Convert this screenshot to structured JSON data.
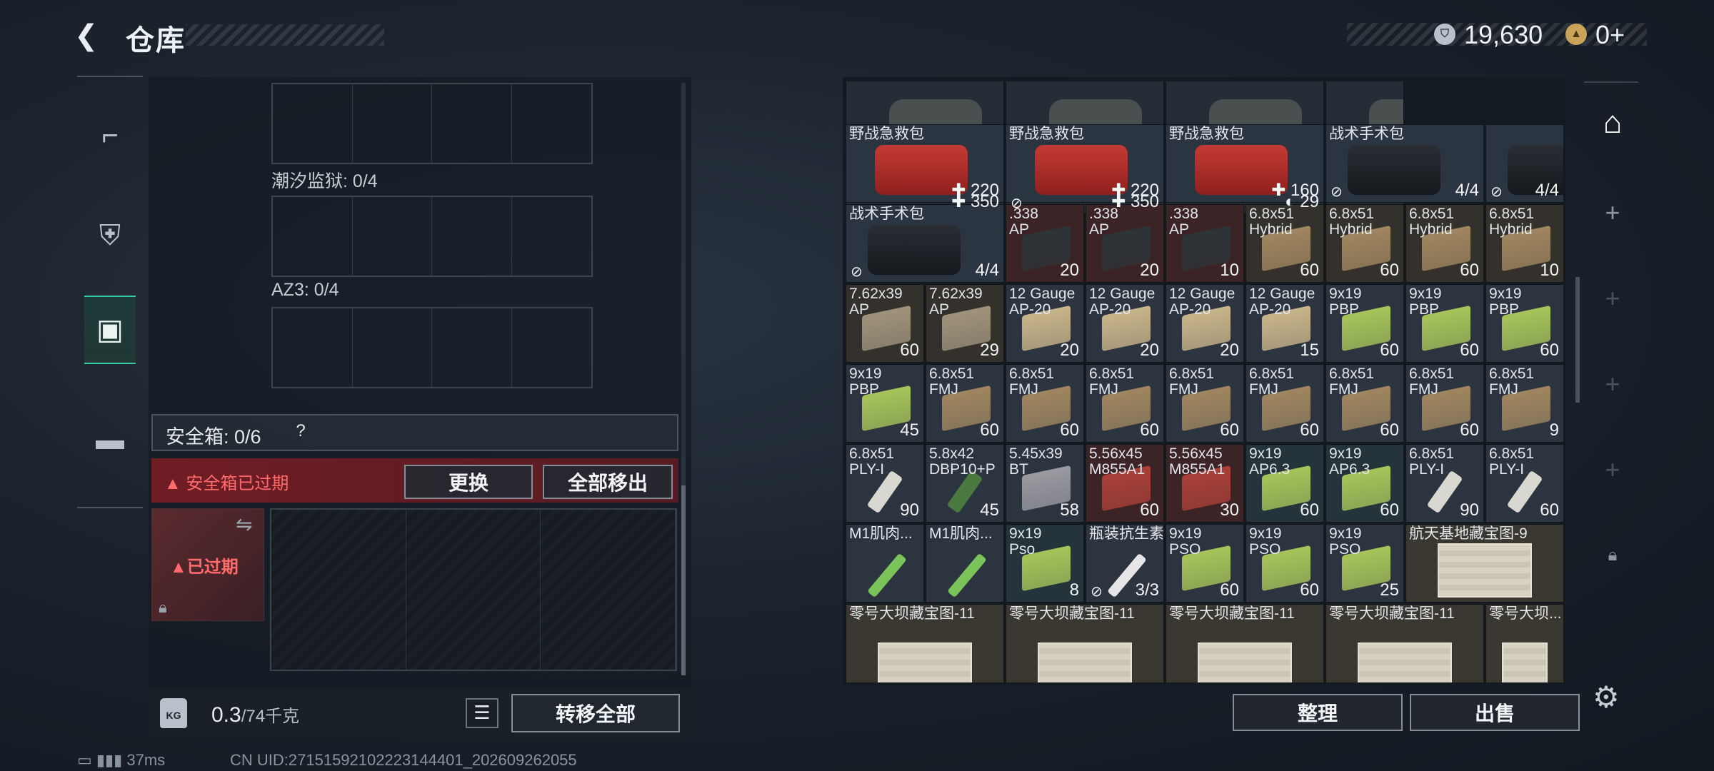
{
  "header": {
    "title": "仓库",
    "back_icon": "back-arrow-icon"
  },
  "currency": {
    "silver": "19,630",
    "gold": "0+"
  },
  "tabs": [
    {
      "name": "weapons",
      "icon": "pistol-icon",
      "active": false
    },
    {
      "name": "armor",
      "icon": "vest-icon",
      "active": false
    },
    {
      "name": "backpack",
      "icon": "backpack-icon",
      "active": true
    },
    {
      "name": "cases",
      "icon": "briefcase-icon",
      "active": false
    }
  ],
  "left": {
    "slot_labels": [
      "潮汐监狱: 0/4",
      "AZ3: 0/4"
    ],
    "safebox": {
      "title": "安全箱: 0/6",
      "help": "?",
      "expired_msg": "安全箱已过期",
      "replace": "更换",
      "move_all": "全部移出",
      "case_label": "已过期"
    },
    "weight": {
      "current": "0.3",
      "max": "/74千克",
      "kg_label": "KG"
    },
    "transfer_all": "转移全部"
  },
  "status": {
    "ping": "37ms",
    "uid": "CN UID:27151592102223144401_202609262055"
  },
  "stash": {
    "rows": [
      [
        {
          "c": "✚ 350",
          "t": "bag"
        },
        {
          "c": "✚ 350",
          "t": "bag",
          "i": "⊘"
        },
        {
          "c": "◐ 29",
          "t": "bag"
        },
        {
          "c": "",
          "t": "bag"
        }
      ],
      [
        {
          "n": "野战急救包",
          "c": "✚ 220",
          "t": "kit"
        },
        {
          "n": "野战急救包",
          "c": "✚ 220",
          "t": "kit"
        },
        {
          "n": "野战急救包",
          "c": "✚ 160",
          "t": "kit"
        },
        {
          "n": "战术手术包",
          "c": "4/4",
          "t": "dkit",
          "i": "⊘"
        },
        {
          "n": "",
          "c": "4/4",
          "t": "dkit",
          "i": "⊘"
        }
      ],
      [
        {
          "n": "战术手术包",
          "c": "4/4",
          "t": "dkit",
          "i": "⊘"
        },
        {
          "n": ".338\nAP",
          "c": "20",
          "t": "ammo",
          "bg": "#3b2326",
          "col": "#2d3438"
        },
        {
          "n": ".338\nAP",
          "c": "20",
          "t": "ammo",
          "bg": "#3b2326",
          "col": "#2d3438"
        },
        {
          "n": ".338\nAP",
          "c": "10",
          "t": "ammo",
          "bg": "#3b2326",
          "col": "#2d3438"
        },
        {
          "n": "6.8x51\nHybrid",
          "c": "60",
          "t": "ammo",
          "bg": "#34302b",
          "col": "#a08660"
        },
        {
          "n": "6.8x51\nHybrid",
          "c": "60",
          "t": "ammo",
          "bg": "#34302b",
          "col": "#a08660"
        },
        {
          "n": "6.8x51\nHybrid",
          "c": "60",
          "t": "ammo",
          "bg": "#34302b",
          "col": "#a08660"
        },
        {
          "n": "6.8x51\nHybrid",
          "c": "10",
          "t": "ammo",
          "bg": "#34302b",
          "col": "#a08660"
        }
      ],
      [
        {
          "n": "7.62x39\nAP",
          "c": "60",
          "t": "ammo",
          "bg": "#34302b",
          "col": "#9f937b"
        },
        {
          "n": "7.62x39\nAP",
          "c": "29",
          "t": "ammo",
          "bg": "#34302b",
          "col": "#9f937b"
        },
        {
          "n": "12 Gauge\nAP-20",
          "c": "20",
          "t": "ammo",
          "bg": "#2c3440",
          "col": "#c9b48a"
        },
        {
          "n": "12 Gauge\nAP-20",
          "c": "20",
          "t": "ammo",
          "bg": "#2c3440",
          "col": "#c9b48a"
        },
        {
          "n": "12 Gauge\nAP-20",
          "c": "20",
          "t": "ammo",
          "bg": "#2c3440",
          "col": "#c9b48a"
        },
        {
          "n": "12 Gauge\nAP-20",
          "c": "15",
          "t": "ammo",
          "bg": "#2c3440",
          "col": "#c9b48a"
        },
        {
          "n": "9x19\nPBP",
          "c": "60",
          "t": "ammo",
          "bg": "#2c3440",
          "col": "#a7c45a"
        },
        {
          "n": "9x19\nPBP",
          "c": "60",
          "t": "ammo",
          "bg": "#2c3440",
          "col": "#a7c45a"
        },
        {
          "n": "9x19\nPBP",
          "c": "60",
          "t": "ammo",
          "bg": "#2c3440",
          "col": "#a7c45a"
        }
      ],
      [
        {
          "n": "9x19\nPBP",
          "c": "45",
          "t": "ammo",
          "bg": "#2c3440",
          "col": "#a7c45a"
        },
        {
          "n": "6.8x51\nFMJ",
          "c": "60",
          "t": "ammo",
          "bg": "#2c3440",
          "col": "#a08660"
        },
        {
          "n": "6.8x51\nFMJ",
          "c": "60",
          "t": "ammo",
          "bg": "#2c3440",
          "col": "#a08660"
        },
        {
          "n": "6.8x51\nFMJ",
          "c": "60",
          "t": "ammo",
          "bg": "#2c3440",
          "col": "#a08660"
        },
        {
          "n": "6.8x51\nFMJ",
          "c": "60",
          "t": "ammo",
          "bg": "#2c3440",
          "col": "#a08660"
        },
        {
          "n": "6.8x51\nFMJ",
          "c": "60",
          "t": "ammo",
          "bg": "#2c3440",
          "col": "#a08660"
        },
        {
          "n": "6.8x51\nFMJ",
          "c": "60",
          "t": "ammo",
          "bg": "#2c3440",
          "col": "#a08660"
        },
        {
          "n": "6.8x51\nFMJ",
          "c": "60",
          "t": "ammo",
          "bg": "#2c3440",
          "col": "#a08660"
        },
        {
          "n": "6.8x51\nFMJ",
          "c": "9",
          "t": "ammo",
          "bg": "#2c3440",
          "col": "#a08660"
        }
      ],
      [
        {
          "n": "6.8x51\nPLY-I",
          "c": "90",
          "t": "round",
          "bg": "#2c3440",
          "col": "#d8d8d0"
        },
        {
          "n": "5.8x42\nDBP10+P",
          "c": "45",
          "t": "round",
          "bg": "#2c3440",
          "col": "#4a7a40"
        },
        {
          "n": "5.45x39\nBT",
          "c": "58",
          "t": "ammo",
          "bg": "#2c3440",
          "col": "#9a9aa0"
        },
        {
          "n": "5.56x45\nM855A1",
          "c": "60",
          "t": "ammo",
          "bg": "#3b2326",
          "col": "#a84038"
        },
        {
          "n": "5.56x45\nM855A1",
          "c": "30",
          "t": "ammo",
          "bg": "#3b2326",
          "col": "#a84038"
        },
        {
          "n": "9x19\nAP6.3",
          "c": "60",
          "t": "ammo",
          "bg": "#25343a",
          "col": "#a7c45a"
        },
        {
          "n": "9x19\nAP6.3",
          "c": "60",
          "t": "ammo",
          "bg": "#25343a",
          "col": "#a7c45a"
        },
        {
          "n": "6.8x51\nPLY-I",
          "c": "90",
          "t": "round",
          "bg": "#2c3440",
          "col": "#d8d8d0"
        },
        {
          "n": "6.8x51\nPLY-I",
          "c": "60",
          "t": "round",
          "bg": "#2c3440",
          "col": "#d8d8d0"
        }
      ],
      [
        {
          "n": "M1肌肉...",
          "c": "",
          "t": "inj",
          "bg": "#2c3440",
          "col": "#7bc45a"
        },
        {
          "n": "M1肌肉...",
          "c": "",
          "t": "inj",
          "bg": "#2c3440",
          "col": "#7bc45a"
        },
        {
          "n": "9x19\nPso",
          "c": "8",
          "t": "ammo",
          "bg": "#25343a",
          "col": "#a7c45a"
        },
        {
          "n": "瓶装抗生素",
          "c": "3/3",
          "t": "inj",
          "bg": "#2c3440",
          "col": "#e6e6e6",
          "i": "⊘"
        },
        {
          "n": "9x19\nPSO",
          "c": "60",
          "t": "ammo",
          "bg": "#2c3440",
          "col": "#a7c45a"
        },
        {
          "n": "9x19\nPSO",
          "c": "60",
          "t": "ammo",
          "bg": "#2c3440",
          "col": "#a7c45a"
        },
        {
          "n": "9x19\nPSO",
          "c": "25",
          "t": "ammo",
          "bg": "#2c3440",
          "col": "#a7c45a"
        },
        {
          "n": "航天基地藏宝图-9",
          "c": "",
          "t": "map",
          "bg": "#3a3630"
        }
      ],
      [
        {
          "n": "零号大坝藏宝图-11",
          "c": "",
          "t": "map",
          "bg": "#3a3630"
        },
        {
          "n": "零号大坝藏宝图-11",
          "c": "",
          "t": "map",
          "bg": "#3a3630"
        },
        {
          "n": "零号大坝藏宝图-11",
          "c": "",
          "t": "map",
          "bg": "#3a3630"
        },
        {
          "n": "零号大坝藏宝图-11",
          "c": "",
          "t": "map",
          "bg": "#3a3630"
        },
        {
          "n": "零号大坝...",
          "c": "",
          "t": "map",
          "bg": "#3a3630"
        }
      ]
    ]
  },
  "right_sidebar": [
    "storage-icon",
    "plus-icon",
    "plus-icon",
    "plus-icon",
    "plus-icon",
    "lock-icon"
  ],
  "actions": {
    "sort": "整理",
    "sell": "出售"
  }
}
